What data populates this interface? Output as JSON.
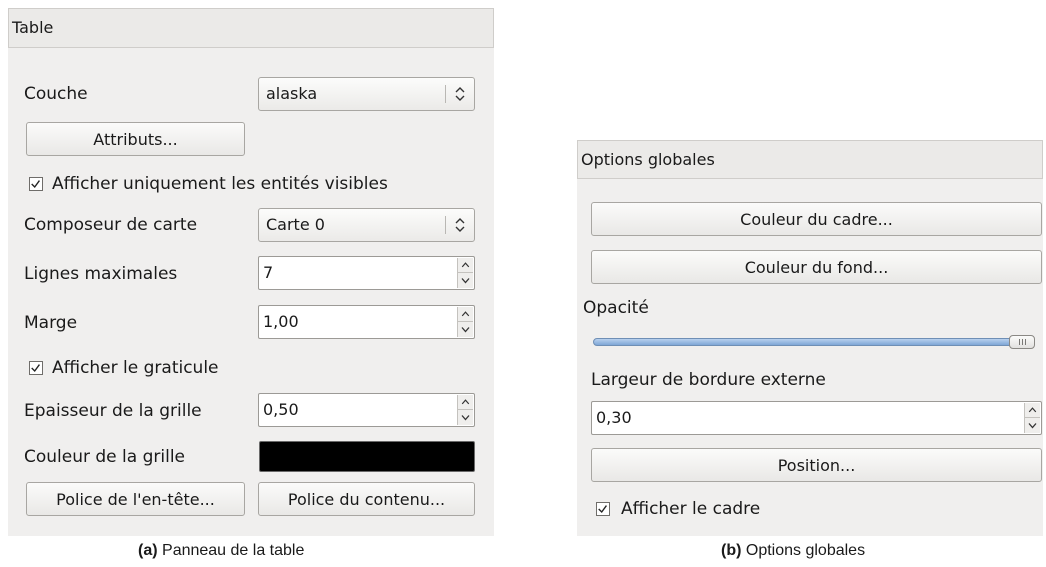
{
  "table_panel": {
    "header": "Table",
    "layer_label": "Couche",
    "layer_value": "alaska",
    "attributes_button": "Attributs...",
    "show_visible_only": {
      "label": "Afficher uniquement les entités visibles",
      "checked": true
    },
    "map_composer_label": "Composeur de carte",
    "map_composer_value": "Carte 0",
    "max_rows_label": "Lignes maximales",
    "max_rows_value": "7",
    "margin_label": "Marge",
    "margin_value": "1,00",
    "show_grid": {
      "label": "Afficher le graticule",
      "checked": true
    },
    "grid_width_label": "Epaisseur de la grille",
    "grid_width_value": "0,50",
    "grid_color_label": "Couleur de la grille",
    "grid_color": "#000000",
    "header_font_button": "Police de l'en-tête...",
    "content_font_button": "Police du contenu..."
  },
  "global_panel": {
    "header": "Options globales",
    "frame_color_button": "Couleur du cadre...",
    "background_color_button": "Couleur du fond...",
    "opacity_label": "Opacité",
    "opacity_fraction": 1.0,
    "outline_width_label": "Largeur de bordure externe",
    "outline_width_value": "0,30",
    "position_button": "Position...",
    "show_frame": {
      "label": "Afficher le cadre",
      "checked": true
    }
  },
  "captions": {
    "a_tag": "(a)",
    "a_text": "Panneau de la table",
    "b_tag": "(b)",
    "b_text": "Options globales"
  },
  "colors": {
    "panel_bg": "#f0efee",
    "slider_fill": "#7fa6d6"
  }
}
